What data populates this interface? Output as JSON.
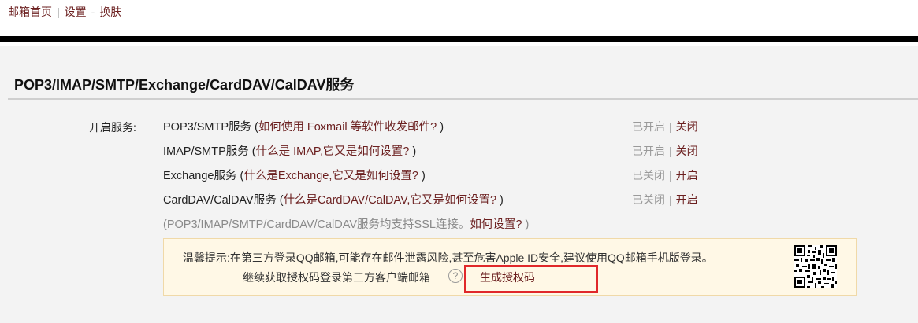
{
  "topnav": {
    "home": "邮箱首页",
    "sep": "|",
    "settings": "设置",
    "dash": "-",
    "skin": "换肤"
  },
  "section": {
    "title": "POP3/IMAP/SMTP/Exchange/CardDAV/CalDAV服务"
  },
  "open_label": "开启服务:",
  "services": [
    {
      "name": "POP3/SMTP服务",
      "open_paren": " (",
      "help": "如何使用 Foxmail 等软件收发邮件?",
      "close_paren": " )",
      "status": "已开启",
      "action": "关闭"
    },
    {
      "name": "IMAP/SMTP服务",
      "open_paren": " (",
      "help": "什么是 IMAP,它又是如何设置?",
      "close_paren": " )",
      "status": "已开启",
      "action": "关闭"
    },
    {
      "name": "Exchange服务",
      "open_paren": " (",
      "help": "什么是Exchange,它又是如何设置?",
      "close_paren": " )",
      "status": "已关闭",
      "action": "开启"
    },
    {
      "name": "CardDAV/CalDAV服务",
      "open_paren": " (",
      "help": "什么是CardDAV/CalDAV,它又是如何设置?",
      "close_paren": " )",
      "status": "已关闭",
      "action": "开启"
    }
  ],
  "status_sep": "|",
  "ssl_note": {
    "text": "(POP3/IMAP/SMTP/CardDAV/CalDAV服务均支持SSL连接。",
    "howto": "如何设置?",
    "close": " )"
  },
  "tip": {
    "line1": "温馨提示:在第三方登录QQ邮箱,可能存在邮件泄露风险,甚至危害Apple ID安全,建议使用QQ邮箱手机版登录。",
    "line2": "继续获取授权码登录第三方客户端邮箱",
    "help_glyph": "?",
    "generate": "生成授权码"
  },
  "colors": {
    "link": "#6b1f1f",
    "highlight_border": "#e0282a",
    "tip_bg": "#fff8e6"
  }
}
